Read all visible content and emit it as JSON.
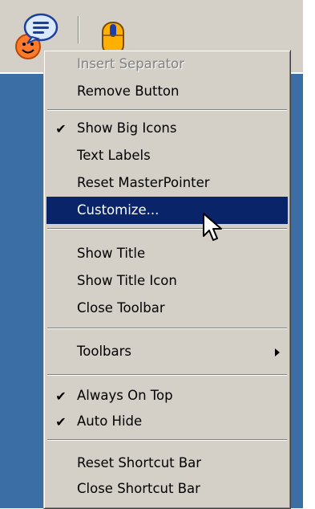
{
  "menu": {
    "items": [
      {
        "label": "Insert Separator",
        "checked": false,
        "disabled": true
      },
      {
        "label": "Remove Button",
        "checked": false
      },
      {
        "label": "Show Big Icons",
        "checked": true
      },
      {
        "label": "Text Labels",
        "checked": false
      },
      {
        "label": "Reset MasterPointer",
        "checked": false
      },
      {
        "label": "Customize...",
        "checked": false,
        "highlighted": true
      },
      {
        "label": "Show Title",
        "checked": false
      },
      {
        "label": "Show Title Icon",
        "checked": false
      },
      {
        "label": "Close Toolbar",
        "checked": false
      },
      {
        "label": "Toolbars",
        "checked": false,
        "submenu": true
      },
      {
        "label": "Always On Top",
        "checked": true
      },
      {
        "label": "Auto Hide",
        "checked": true
      },
      {
        "label": "Reset Shortcut Bar",
        "checked": false
      },
      {
        "label": "Close Shortcut Bar",
        "checked": false
      }
    ],
    "check_glyph": "✔"
  },
  "icons": {
    "toolbar_left": "chat-smiley-icon",
    "toolbar_right": "mouse-icon",
    "cursor": "mouse-pointer-icon"
  },
  "colors": {
    "menu_bg": "#d4d0c8",
    "highlight_bg": "#0a246a",
    "desktop": "#3a6ea5"
  }
}
